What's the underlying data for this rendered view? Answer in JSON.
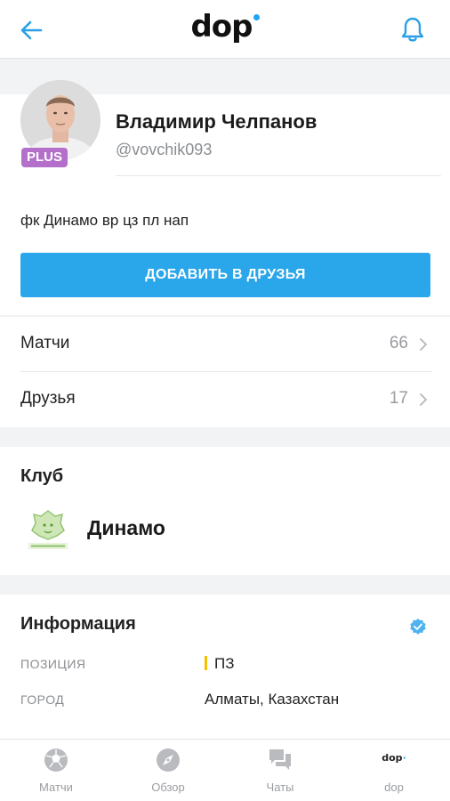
{
  "header": {
    "logo_text": "dop",
    "accent_color": "#1ea7f0"
  },
  "profile": {
    "name": "Владимир Челпанов",
    "username": "@vovchik093",
    "badge": "PLUS"
  },
  "bio": {
    "text": "фк Динамо вр цз пл нап",
    "add_friend_label": "ДОБАВИТЬ В ДРУЗЬЯ"
  },
  "stats": [
    {
      "label": "Матчи",
      "count": "66"
    },
    {
      "label": "Друзья",
      "count": "17"
    }
  ],
  "club": {
    "title": "Клуб",
    "name": "Динамо",
    "logo_icon": "dinamo-lion-crest-icon"
  },
  "info": {
    "title": "Информация",
    "rows": [
      {
        "key": "ПОЗИЦИЯ",
        "value": "ПЗ"
      },
      {
        "key": "ГОРОД",
        "value": "Алматы, Казахстан"
      }
    ]
  },
  "bottom_nav": [
    {
      "label": "Матчи",
      "icon": "soccer-ball-icon"
    },
    {
      "label": "Обзор",
      "icon": "compass-icon"
    },
    {
      "label": "Чаты",
      "icon": "chat-bubbles-icon"
    },
    {
      "label": "dop",
      "icon": "dop-logo-icon"
    }
  ]
}
